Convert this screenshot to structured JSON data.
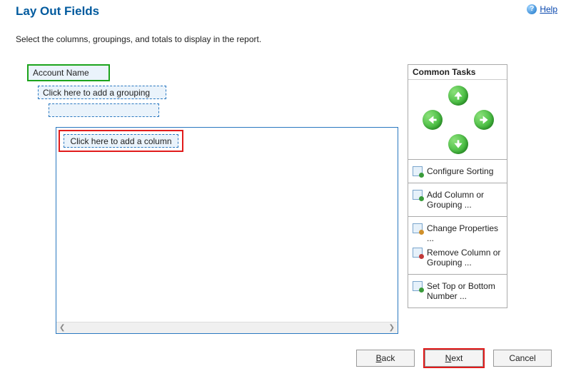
{
  "header": {
    "title": "Lay Out Fields",
    "help_label": "Help"
  },
  "instruction": "Select the columns, groupings, and totals to display in the report.",
  "layout": {
    "account_field": "Account Name",
    "add_grouping_placeholder": "Click here to add a grouping",
    "add_column_placeholder": "Click here to add a column"
  },
  "tasks": {
    "title": "Common Tasks",
    "arrows": {
      "up": "Move Up",
      "down": "Move Down",
      "left": "Move Left",
      "right": "Move Right"
    },
    "configure_sorting": "Configure Sorting",
    "add_column_or_grouping": "Add Column or Grouping ...",
    "change_properties": "Change Properties ...",
    "remove_column_or_grouping": "Remove Column or Grouping ...",
    "set_top_bottom": "Set Top or Bottom Number ..."
  },
  "buttons": {
    "back": "Back",
    "next": "Next",
    "cancel": "Cancel"
  }
}
